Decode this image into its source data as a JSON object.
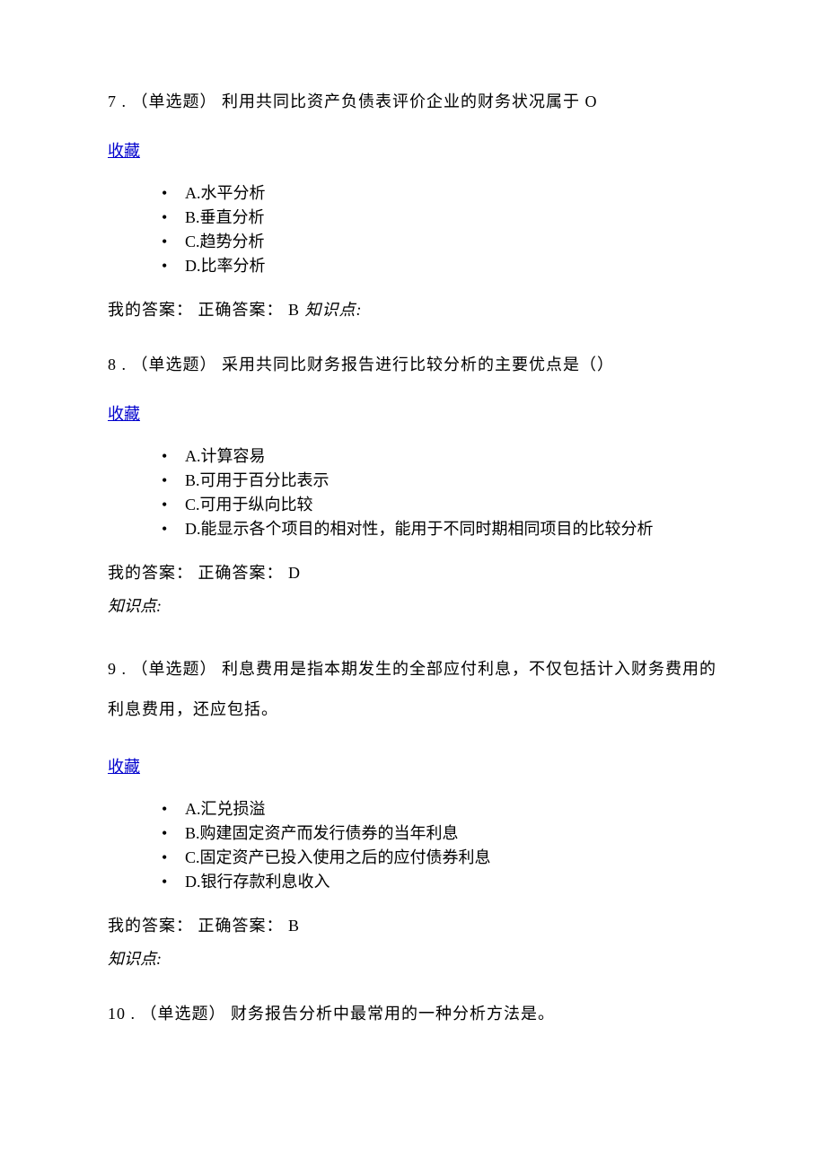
{
  "labels": {
    "favorite": "收藏",
    "my_answer_prefix": "我的答案：",
    "correct_answer_prefix": "正确答案：",
    "knowledge_point": "知识点:"
  },
  "questions": [
    {
      "number": "7",
      "type": "（单选题）",
      "text": "利用共同比资产负债表评价企业的财务状况属于 O",
      "options": [
        "A.水平分析",
        "B.垂直分析",
        "C.趋势分析",
        "D.比率分析"
      ],
      "correct": "B",
      "kp_inline": true
    },
    {
      "number": "8",
      "type": "（单选题）",
      "text": "采用共同比财务报告进行比较分析的主要优点是（）",
      "options": [
        "A.计算容易",
        "B.可用于百分比表示",
        "C.可用于纵向比较",
        "D.能显示各个项目的相对性，能用于不同时期相同项目的比较分析"
      ],
      "correct": "D",
      "kp_inline": false
    },
    {
      "number": "9",
      "type": "（单选题）",
      "text": "利息费用是指本期发生的全部应付利息，不仅包括计入财务费用的利息费用，还应包括。",
      "options": [
        "A.汇兑损溢",
        "B.购建固定资产而发行债券的当年利息",
        "C.固定资产已投入使用之后的应付债券利息",
        "D.银行存款利息收入"
      ],
      "correct": "B",
      "kp_inline": false
    },
    {
      "number": "10",
      "type": "（单选题）",
      "text": "财务报告分析中最常用的一种分析方法是。"
    }
  ]
}
